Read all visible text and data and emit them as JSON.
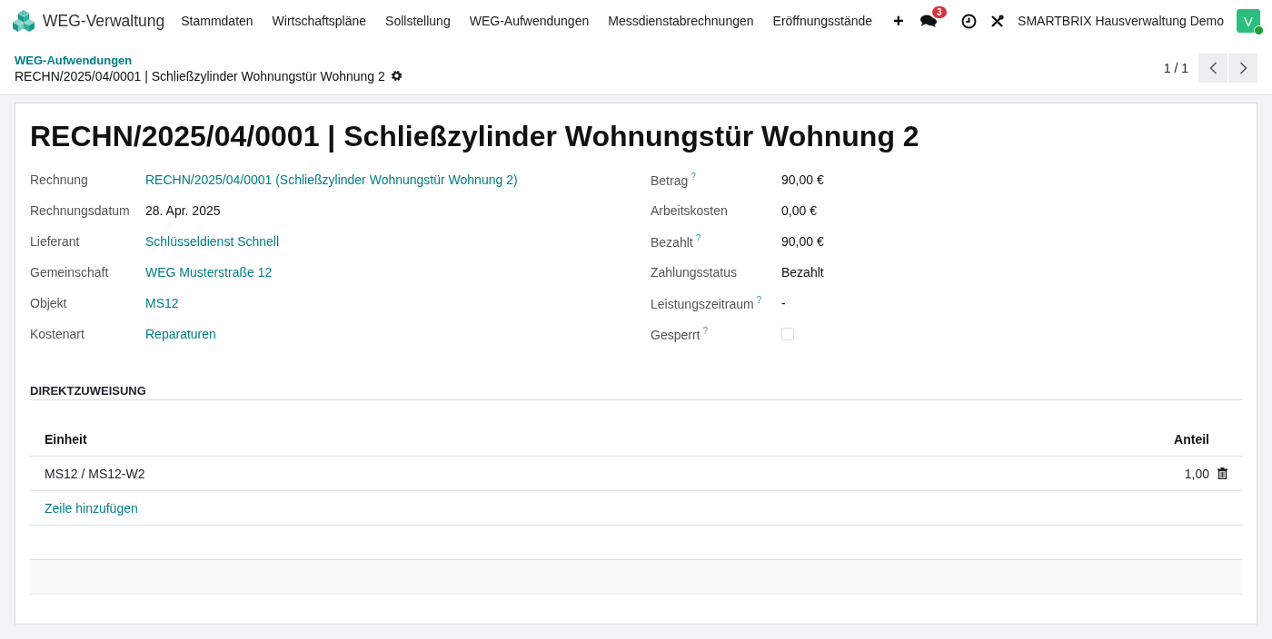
{
  "navbar": {
    "app_name": "WEG-Verwaltung",
    "menu": [
      "Stammdaten",
      "Wirtschaftspläne",
      "Sollstellung",
      "WEG-Aufwendungen",
      "Messdienstabrechnungen",
      "Eröffnungsstände"
    ],
    "plus": "+",
    "messages_badge": "3",
    "company": "SMARTBRIX Hausverwaltung Demo",
    "avatar": "V",
    "avatar_online": true
  },
  "breadcrumb": {
    "parent": "WEG-Aufwendungen",
    "current": "RECHN/2025/04/0001 | Schließzylinder Wohnungstür Wohnung 2"
  },
  "pager": {
    "value": "1 / 1"
  },
  "form": {
    "title": "RECHN/2025/04/0001 | Schließzylinder Wohnungstür Wohnung 2",
    "left_fields": [
      {
        "label": "Rechnung",
        "value": "RECHN/2025/04/0001 (Schließzylinder Wohnungstür Wohnung 2)",
        "kind": "link"
      },
      {
        "label": "Rechnungsdatum",
        "value": "28. Apr. 2025",
        "kind": "text"
      },
      {
        "label": "Lieferant",
        "value": "Schlüsseldienst Schnell",
        "kind": "link"
      },
      {
        "label": "Gemeinschaft",
        "value": "WEG Musterstraße 12",
        "kind": "link"
      },
      {
        "label": "Objekt",
        "value": "MS12",
        "kind": "link"
      },
      {
        "label": "Kostenart",
        "value": "Reparaturen",
        "kind": "link"
      }
    ],
    "right_fields": [
      {
        "label": "Betrag",
        "help": "?",
        "value": "90,00 €",
        "kind": "text"
      },
      {
        "label": "Arbeitskosten",
        "value": "0,00 €",
        "kind": "text"
      },
      {
        "label": "Bezahlt",
        "help": "?",
        "value": "90,00 €",
        "kind": "text"
      },
      {
        "label": "Zahlungsstatus",
        "value": "Bezahlt",
        "kind": "text"
      },
      {
        "label": "Leistungszeitraum",
        "help": "?",
        "value": "-",
        "kind": "text"
      },
      {
        "label": "Gesperrt",
        "help": "?",
        "kind": "checkbox",
        "checked": false
      }
    ],
    "section": {
      "title": "DIREKTZUWEISUNG",
      "columns": [
        "Einheit",
        "Anteil"
      ],
      "rows": [
        {
          "einheit": "MS12 / MS12-W2",
          "anteil": "1,00"
        }
      ],
      "add_line": "Zeile hinzufügen"
    }
  }
}
